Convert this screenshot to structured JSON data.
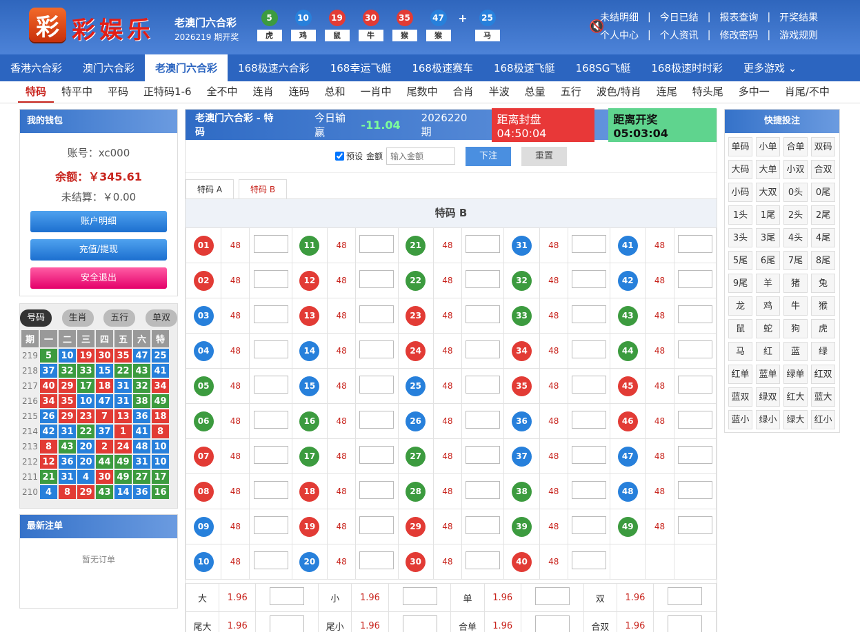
{
  "header": {
    "logo_char": "彩",
    "logo_text": "彩娱乐",
    "game_name": "老澳门六合彩",
    "issue_text": "2026219 期开奖",
    "balls": [
      {
        "num": "5",
        "zodiac": "虎",
        "color": "#3c9b3f"
      },
      {
        "num": "10",
        "zodiac": "鸡",
        "color": "#2780db"
      },
      {
        "num": "19",
        "zodiac": "鼠",
        "color": "#e23b35"
      },
      {
        "num": "30",
        "zodiac": "牛",
        "color": "#e23b35"
      },
      {
        "num": "35",
        "zodiac": "猴",
        "color": "#e23b35"
      },
      {
        "num": "47",
        "zodiac": "猴",
        "color": "#2780db"
      },
      {
        "num": "25",
        "zodiac": "马",
        "color": "#2780db"
      }
    ],
    "plus": "+",
    "links_row1": [
      "未结明细",
      "今日已结",
      "报表查询",
      "开奖结果"
    ],
    "links_row2": [
      "个人中心",
      "个人资讯",
      "修改密码",
      "游戏规则"
    ],
    "sep": "|"
  },
  "nav": [
    "香港六合彩",
    "澳门六合彩",
    "老澳门六合彩",
    "168极速六合彩",
    "168幸运飞艇",
    "168极速赛车",
    "168极速飞艇",
    "168SG飞艇",
    "168极速时时彩",
    "更多游戏"
  ],
  "nav_active": 2,
  "subnav": [
    "特码",
    "特平中",
    "平码",
    "正特码1-6",
    "全不中",
    "连肖",
    "连码",
    "总和",
    "一肖中",
    "尾数中",
    "合肖",
    "半波",
    "总量",
    "五行",
    "波色/特肖",
    "连尾",
    "特头尾",
    "多中一",
    "肖尾/不中"
  ],
  "wallet": {
    "title": "我的钱包",
    "account": "账号：xc000",
    "balance": "余额：￥345.61",
    "unsettled": "未结算：￥0.00",
    "btn_detail": "账户明细",
    "btn_recharge": "充值/提现",
    "btn_logout": "安全退出"
  },
  "history": {
    "tabs": [
      "号码",
      "生肖",
      "五行",
      "单双"
    ],
    "headers": [
      "期",
      "一",
      "二",
      "三",
      "四",
      "五",
      "六",
      "特"
    ],
    "rows": [
      {
        "p": "219",
        "n": [
          [
            "5",
            "g"
          ],
          [
            "10",
            "b"
          ],
          [
            "19",
            "r"
          ],
          [
            "30",
            "r"
          ],
          [
            "35",
            "r"
          ],
          [
            "47",
            "b"
          ],
          [
            "25",
            "b"
          ]
        ]
      },
      {
        "p": "218",
        "n": [
          [
            "37",
            "b"
          ],
          [
            "32",
            "g"
          ],
          [
            "33",
            "g"
          ],
          [
            "15",
            "b"
          ],
          [
            "22",
            "g"
          ],
          [
            "43",
            "g"
          ],
          [
            "41",
            "b"
          ]
        ]
      },
      {
        "p": "217",
        "n": [
          [
            "40",
            "r"
          ],
          [
            "29",
            "r"
          ],
          [
            "17",
            "g"
          ],
          [
            "18",
            "r"
          ],
          [
            "31",
            "b"
          ],
          [
            "32",
            "g"
          ],
          [
            "34",
            "r"
          ]
        ]
      },
      {
        "p": "216",
        "n": [
          [
            "34",
            "r"
          ],
          [
            "35",
            "r"
          ],
          [
            "10",
            "b"
          ],
          [
            "47",
            "b"
          ],
          [
            "31",
            "b"
          ],
          [
            "38",
            "g"
          ],
          [
            "49",
            "g"
          ]
        ]
      },
      {
        "p": "215",
        "n": [
          [
            "26",
            "b"
          ],
          [
            "29",
            "r"
          ],
          [
            "23",
            "r"
          ],
          [
            "7",
            "r"
          ],
          [
            "13",
            "r"
          ],
          [
            "36",
            "b"
          ],
          [
            "18",
            "r"
          ]
        ]
      },
      {
        "p": "214",
        "n": [
          [
            "42",
            "b"
          ],
          [
            "31",
            "b"
          ],
          [
            "22",
            "g"
          ],
          [
            "37",
            "b"
          ],
          [
            "1",
            "r"
          ],
          [
            "41",
            "b"
          ],
          [
            "8",
            "r"
          ]
        ]
      },
      {
        "p": "213",
        "n": [
          [
            "8",
            "r"
          ],
          [
            "43",
            "g"
          ],
          [
            "20",
            "b"
          ],
          [
            "2",
            "r"
          ],
          [
            "24",
            "r"
          ],
          [
            "48",
            "b"
          ],
          [
            "10",
            "b"
          ]
        ]
      },
      {
        "p": "212",
        "n": [
          [
            "12",
            "r"
          ],
          [
            "36",
            "b"
          ],
          [
            "20",
            "b"
          ],
          [
            "44",
            "g"
          ],
          [
            "49",
            "g"
          ],
          [
            "31",
            "b"
          ],
          [
            "10",
            "b"
          ]
        ]
      },
      {
        "p": "211",
        "n": [
          [
            "21",
            "g"
          ],
          [
            "31",
            "b"
          ],
          [
            "4",
            "b"
          ],
          [
            "30",
            "r"
          ],
          [
            "49",
            "g"
          ],
          [
            "27",
            "g"
          ],
          [
            "17",
            "g"
          ]
        ]
      },
      {
        "p": "210",
        "n": [
          [
            "4",
            "b"
          ],
          [
            "8",
            "r"
          ],
          [
            "29",
            "r"
          ],
          [
            "43",
            "g"
          ],
          [
            "14",
            "b"
          ],
          [
            "36",
            "b"
          ],
          [
            "16",
            "g"
          ]
        ]
      }
    ]
  },
  "orders": {
    "title": "最新注单",
    "empty": "暂无订单"
  },
  "main": {
    "title": "老澳门六合彩 - 特码",
    "pl_label": "今日输赢",
    "pl_value": "-11.04",
    "issue": "2026220 期",
    "close_label": "距离封盘 04:50:04",
    "draw_label": "距离开奖 05:03:04",
    "preset_label": "预设",
    "amount_label": "金额",
    "amount_placeholder": "输入金额",
    "submit": "下注",
    "reset": "重置",
    "tabs": [
      "特码 A",
      "特码 B"
    ],
    "grid_title": "特码 B",
    "odds": "48",
    "extra": [
      [
        "大",
        "1.96",
        "小",
        "1.96",
        "单",
        "1.96",
        "双",
        "1.96"
      ],
      [
        "尾大",
        "1.96",
        "尾小",
        "1.96",
        "合单",
        "1.96",
        "合双",
        "1.96"
      ]
    ]
  },
  "quick": {
    "title": "快捷投注",
    "items": [
      "单码",
      "小单",
      "合单",
      "双码",
      "大码",
      "大单",
      "小双",
      "合双",
      "小码",
      "大双",
      "0头",
      "0尾",
      "1头",
      "1尾",
      "2头",
      "2尾",
      "3头",
      "3尾",
      "4头",
      "4尾",
      "5尾",
      "6尾",
      "7尾",
      "8尾",
      "9尾",
      "羊",
      "猪",
      "兔",
      "龙",
      "鸡",
      "牛",
      "猴",
      "鼠",
      "蛇",
      "狗",
      "虎",
      "马",
      "红",
      "蓝",
      "绿",
      "红单",
      "蓝单",
      "绿单",
      "红双",
      "蓝双",
      "绿双",
      "红大",
      "蓝大",
      "蓝小",
      "绿小",
      "绿大",
      "红小"
    ]
  },
  "colors": {
    "red": "#e23b35",
    "blue": "#2780db",
    "green": "#3c9b3f",
    "accent": "#c8241d"
  }
}
